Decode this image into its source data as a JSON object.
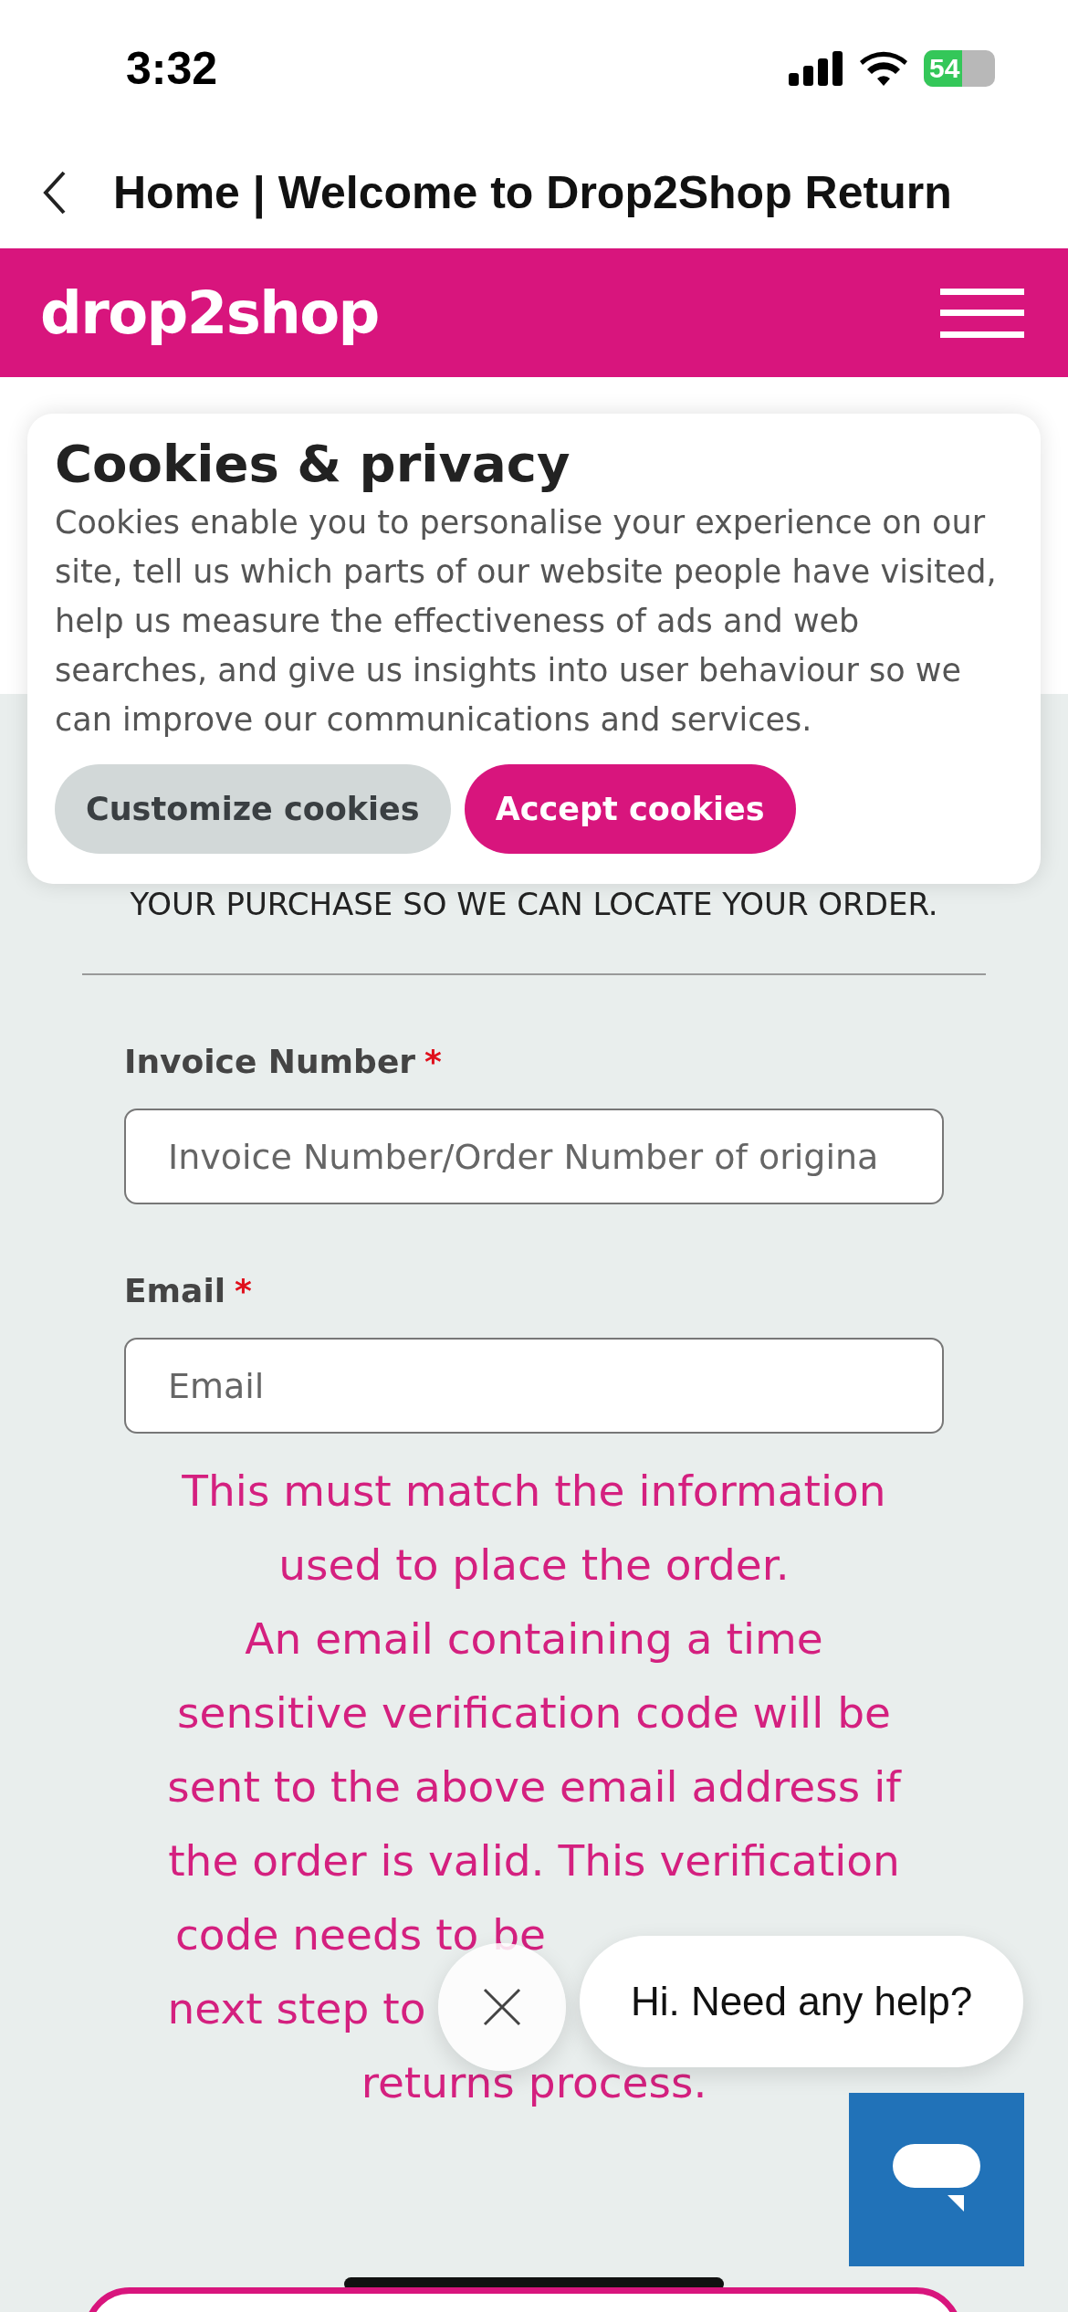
{
  "status_bar": {
    "time": "3:32",
    "battery": "54"
  },
  "nav": {
    "title": "Home | Welcome to Drop2Shop Return"
  },
  "header": {
    "logo": "drop2shop"
  },
  "page": {
    "intro": "YOUR PURCHASE SO WE CAN LOCATE YOUR ORDER."
  },
  "form": {
    "fields": [
      {
        "label": "Invoice Number",
        "required_mark": "*",
        "placeholder": "Invoice Number/Order Number of origina"
      },
      {
        "label": "Email",
        "required_mark": "*",
        "placeholder": "Email"
      }
    ],
    "note_lines": [
      "This must match the information",
      "used to place the order.",
      "An email containing a time",
      "sensitive verification code will be",
      "sent to the above email address if",
      "the order is valid. This verification",
      "code needs to be",
      "next step to",
      "returns process."
    ]
  },
  "cookie_banner": {
    "title": "Cookies & privacy",
    "text": "Cookies enable you to personalise your experience on our site, tell us which parts of our website people have visited, help us measure the effectiveness of ads and web searches, and give us insights into user behaviour so we can improve our communications and services.",
    "buttons": [
      {
        "label": "Customize cookies",
        "kind": "secondary"
      },
      {
        "label": "Accept cookies",
        "kind": "primary"
      }
    ]
  },
  "chat": {
    "greeting": "Hi. Need any help?"
  }
}
